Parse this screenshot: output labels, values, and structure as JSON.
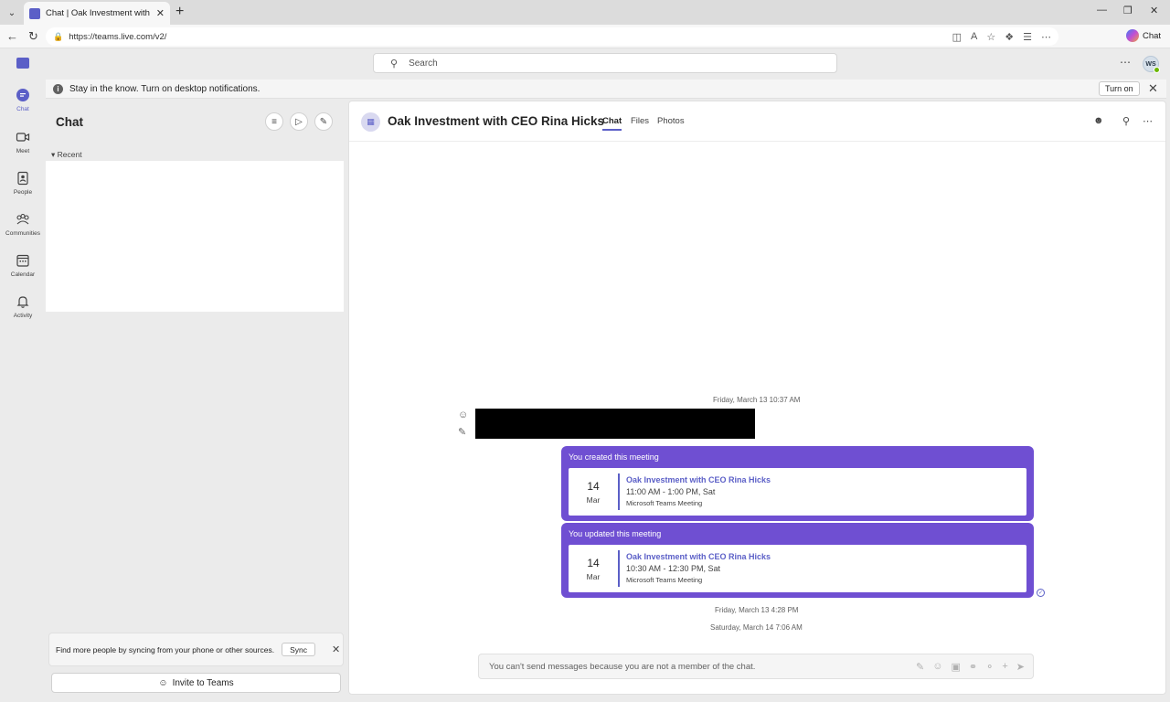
{
  "browser": {
    "tab_title": "Chat | Oak Investment with CEO R",
    "url": "https://teams.live.com/v2/",
    "chat_label": "Chat"
  },
  "teams": {
    "search_placeholder": "Search",
    "avatar_initials": "WS",
    "rail": [
      {
        "label": "Chat",
        "icon": "chat-icon"
      },
      {
        "label": "Meet",
        "icon": "video-icon"
      },
      {
        "label": "People",
        "icon": "people-icon"
      },
      {
        "label": "Communities",
        "icon": "communities-icon"
      },
      {
        "label": "Calendar",
        "icon": "calendar-icon"
      },
      {
        "label": "Activity",
        "icon": "bell-icon"
      }
    ]
  },
  "banner": {
    "text": "Stay in the know. Turn on desktop notifications.",
    "button": "Turn on"
  },
  "chat_list": {
    "title": "Chat",
    "recent_label": "Recent",
    "sync_text": "Find more people by syncing from your phone or other sources.",
    "sync_button": "Sync",
    "invite_button": "Invite to Teams"
  },
  "conversation": {
    "title": "Oak Investment with CEO Rina Hicks",
    "tabs": [
      "Chat",
      "Files",
      "Photos"
    ],
    "stamp1": "Friday, March 13 10:37 AM",
    "meetings": [
      {
        "header": "You created this meeting",
        "day": "14",
        "month": "Mar",
        "name": "Oak Investment with CEO Rina Hicks",
        "time": "11:00 AM - 1:00 PM, Sat",
        "type": "Microsoft Teams Meeting"
      },
      {
        "header": "You updated this meeting",
        "day": "14",
        "month": "Mar",
        "name": "Oak Investment with CEO Rina Hicks",
        "time": "10:30 AM - 12:30 PM, Sat",
        "type": "Microsoft Teams Meeting"
      }
    ],
    "stamp2": "Friday, March 13 4:28 PM",
    "stamp3": "Saturday, March 14 7:06 AM",
    "compose_text": "You can't send messages because you are not a member of the chat."
  },
  "colors": {
    "brand": "#5b5fc7",
    "meeting_bg": "#6f4fd2"
  }
}
